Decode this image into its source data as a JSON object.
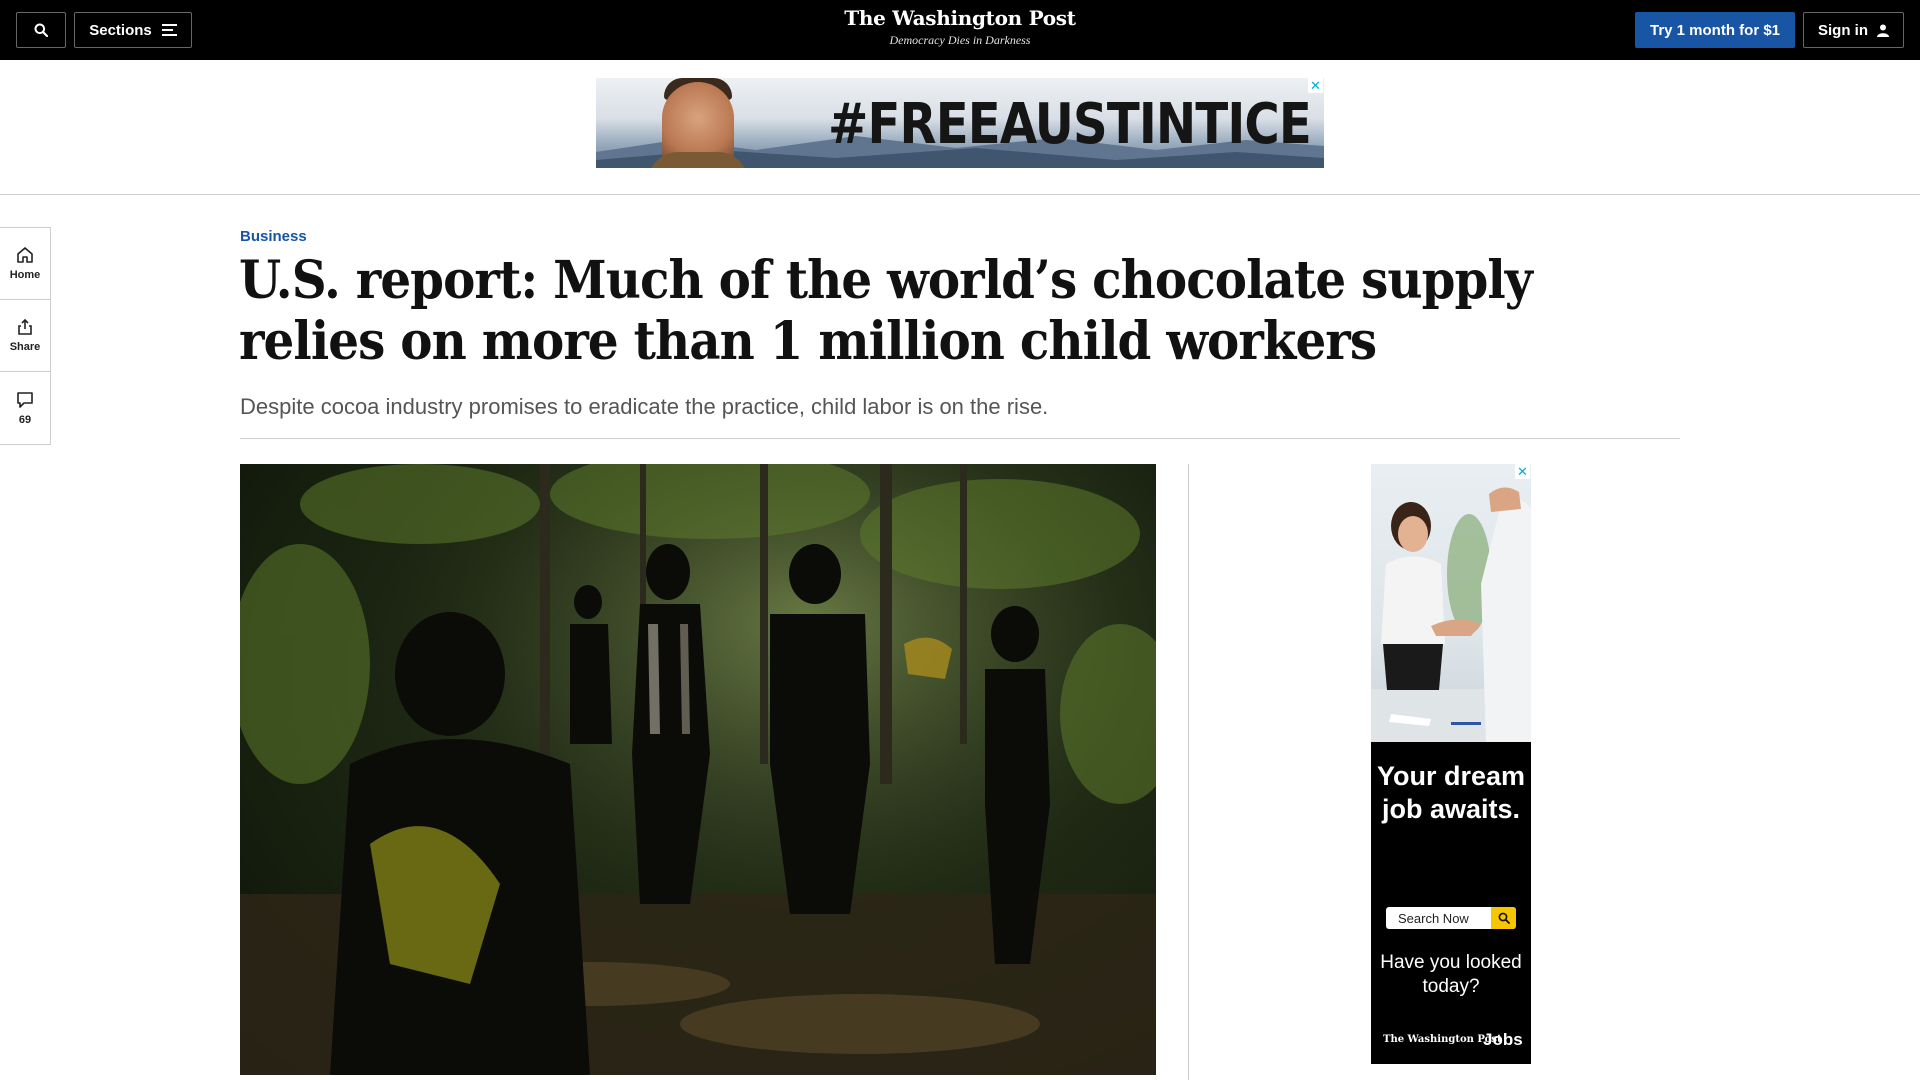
{
  "nav": {
    "sections_label": "Sections",
    "logo_title": "The Washington Post",
    "logo_tagline": "Democracy Dies in Darkness",
    "subscribe_label": "Try 1 month for $1",
    "signin_label": "Sign in",
    "icons": [
      "search-icon",
      "menu-icon",
      "user-icon"
    ]
  },
  "top_ad": {
    "text": "#FREEAUSTINTICE",
    "close_glyph": "✕"
  },
  "rail": {
    "home_label": "Home",
    "share_label": "Share",
    "comments_count": "69"
  },
  "article": {
    "kicker": "Business",
    "headline": "U.S. report: Much of the world’s chocolate supply relies on more than 1 million child workers",
    "subhead": "Despite cocoa industry promises to eradicate the practice, child labor is on the rise."
  },
  "side_ad": {
    "headline": "Your dream job awaits.",
    "search_placeholder": "Search Now",
    "subtext": "Have you looked today?",
    "brand": "The Washington Post",
    "product": "Jobs",
    "close_glyph": "✕"
  },
  "colors": {
    "nav_bg": "#000000",
    "accent_blue": "#1955a5",
    "ad_search_yellow": "#f7c600"
  }
}
